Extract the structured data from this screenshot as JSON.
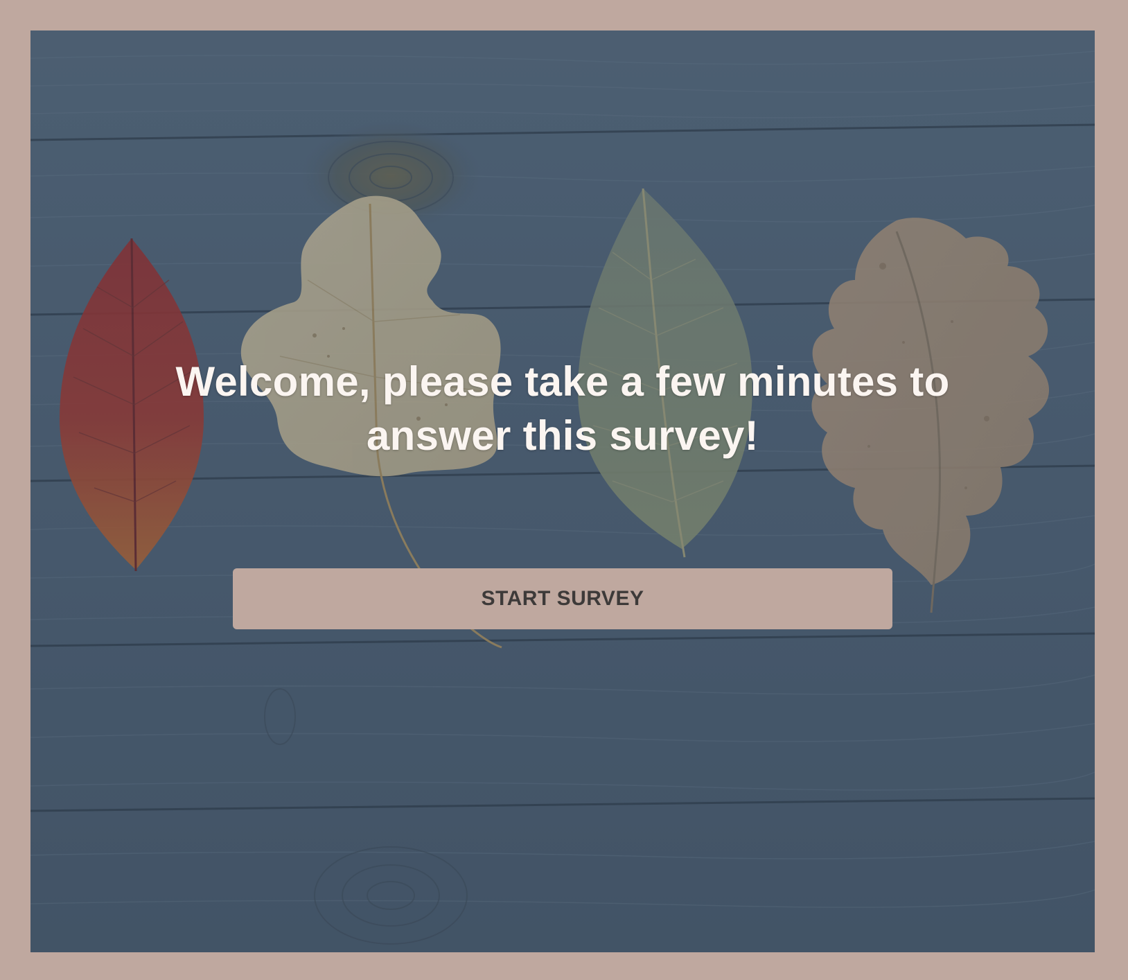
{
  "page": {
    "title": "Welcome, please take a few minutes to answer this survey!",
    "start_button_label": "START SURVEY"
  },
  "colors": {
    "frame": "#bfa89f",
    "overlay": "#4c5e70",
    "title_text": "#fbf5f1",
    "button_bg": "#bfa89f",
    "button_text": "#3d3a39"
  },
  "background": {
    "subject": "wooden-planks-with-autumn-leaves",
    "leaves": [
      "red-leaf",
      "cream-maple-leaf",
      "green-leaf",
      "tan-oak-leaf"
    ]
  }
}
